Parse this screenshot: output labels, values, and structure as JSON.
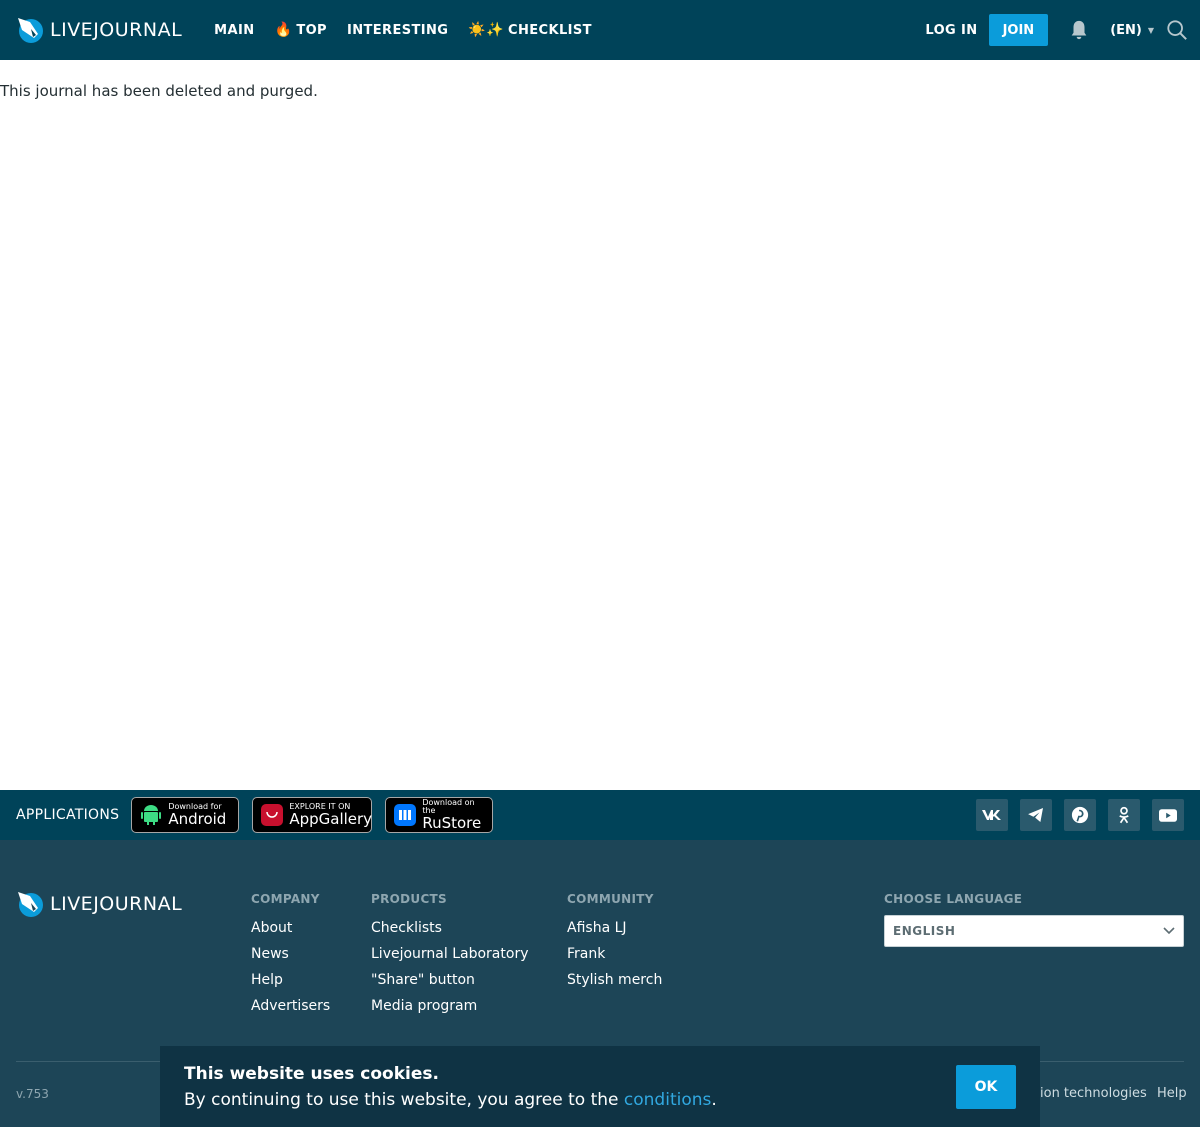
{
  "header": {
    "logo_text": "LIVEJOURNAL",
    "nav": [
      {
        "label": "MAIN",
        "emoji": ""
      },
      {
        "label": "TOP",
        "emoji": "🔥"
      },
      {
        "label": "INTERESTING",
        "emoji": ""
      },
      {
        "label": "CHECKLIST",
        "emoji": "☀️✨"
      }
    ],
    "login_label": "LOG IN",
    "join_label": "JOIN",
    "language_label": "(EN)"
  },
  "content": {
    "message": "This journal has been deleted and purged."
  },
  "apps": {
    "label": "APPLICATIONS",
    "badges": [
      {
        "small": "Download for",
        "big": "Android"
      },
      {
        "small": "EXPLORE IT ON",
        "big": "AppGallery"
      },
      {
        "small": "Download on the",
        "big": "RuStore"
      }
    ]
  },
  "footer": {
    "logo_text": "LIVEJOURNAL",
    "columns": [
      {
        "title": "COMPANY",
        "links": [
          "About",
          "News",
          "Help",
          "Advertisers"
        ]
      },
      {
        "title": "PRODUCTS",
        "links": [
          "Checklists",
          "Livejournal Laboratory",
          "\"Share\" button",
          "Media program"
        ]
      },
      {
        "title": "COMMUNITY",
        "links": [
          "Afisha LJ",
          "Frank",
          "Stylish merch"
        ]
      }
    ],
    "language_title": "CHOOSE LANGUAGE",
    "language_value": "ENGLISH",
    "version": "v.753",
    "bottom_links": [
      "ion technologies",
      "Help"
    ]
  },
  "cookie": {
    "title": "This website uses cookies.",
    "body_prefix": "By continuing to use this website, you agree to the ",
    "link": "conditions",
    "body_suffix": ".",
    "ok_label": "OK"
  },
  "colors": {
    "header_bg": "#004359",
    "accent": "#0b9cda",
    "footer_bg": "#1d4557",
    "cookie_bg": "#0f3344"
  }
}
